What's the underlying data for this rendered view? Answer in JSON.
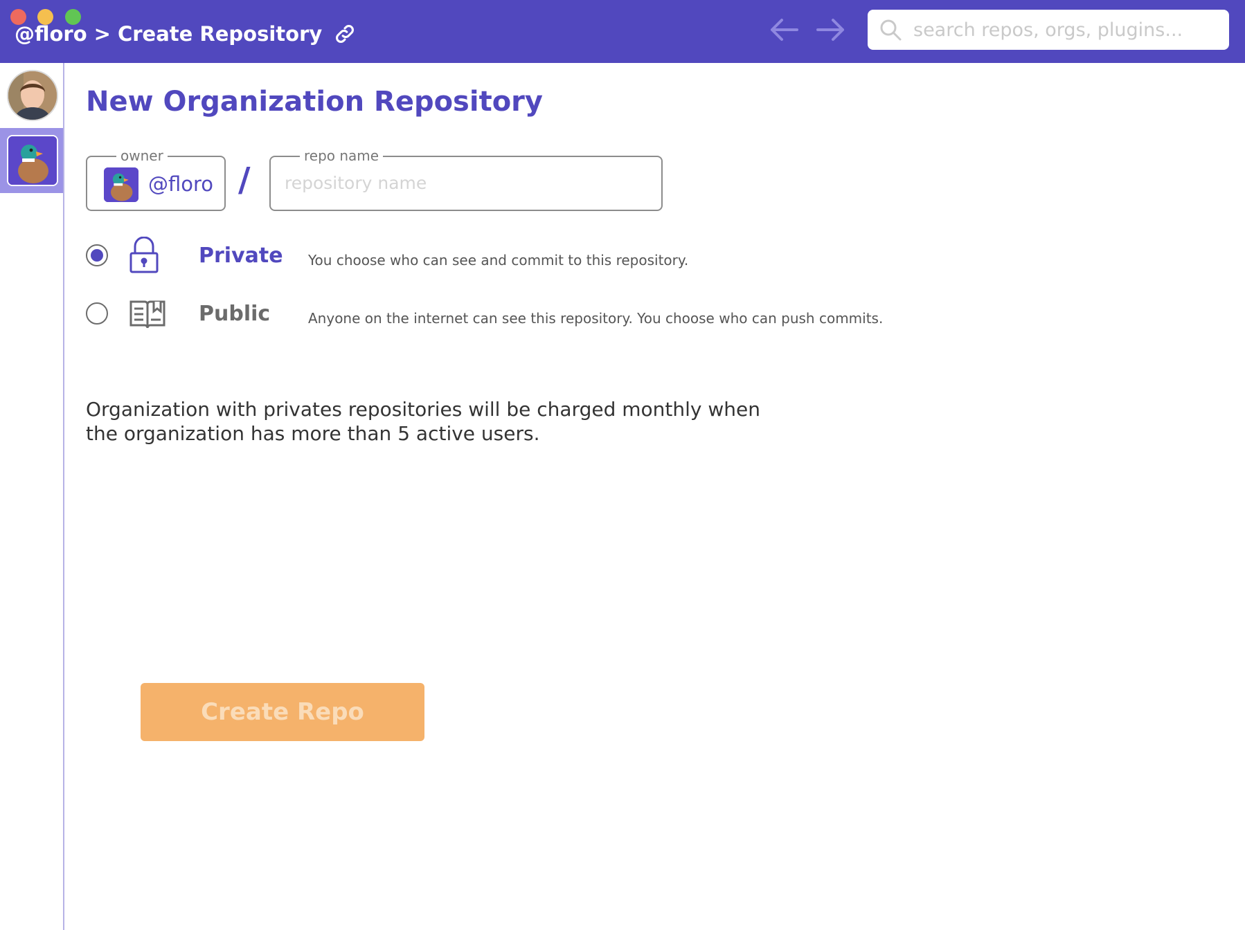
{
  "window": {
    "breadcrumb_owner": "@floro",
    "breadcrumb_separator": ">",
    "breadcrumb_page": "Create Repository",
    "traffic_lights": [
      "#ee6a5e",
      "#f5bf4f",
      "#61c554"
    ]
  },
  "nav": {
    "back_icon": "arrow-left-icon",
    "forward_icon": "arrow-right-icon"
  },
  "search": {
    "placeholder": "search repos, orgs, plugins..."
  },
  "sidebar": {
    "items": [
      {
        "name": "user-avatar",
        "icon": "user-photo"
      },
      {
        "name": "org-floro",
        "icon": "duck-logo-icon",
        "selected": true
      }
    ]
  },
  "form": {
    "title": "New Organization Repository",
    "owner_label": "owner",
    "owner_value": "@floro",
    "slash": "/",
    "repo_name_label": "repo name",
    "repo_name_placeholder": "repository name",
    "repo_name_value": "",
    "visibility": [
      {
        "id": "private",
        "label": "Private",
        "description": "You choose who can see and commit to this repository.",
        "icon": "lock-icon",
        "selected": true
      },
      {
        "id": "public",
        "label": "Public",
        "description": "Anyone on the internet can see this repository. You choose who can push commits.",
        "icon": "book-icon",
        "selected": false
      }
    ],
    "notice": "Organization with privates repositories will be charged monthly when the organization has more than 5 active users.",
    "submit_label": "Create Repo"
  },
  "colors": {
    "brand": "#5148be",
    "selected_sidebar": "#9b93e6",
    "button_disabled_bg": "#f5b26b",
    "button_disabled_text": "#fadcb9"
  }
}
